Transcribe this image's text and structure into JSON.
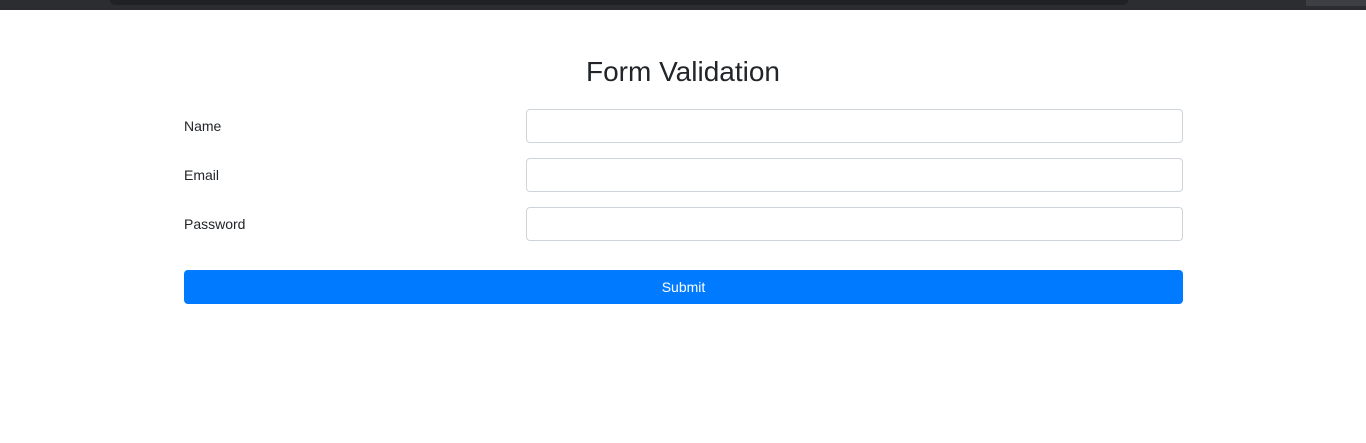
{
  "page": {
    "title": "Form Validation"
  },
  "form": {
    "fields": [
      {
        "label": "Name",
        "value": "",
        "placeholder": ""
      },
      {
        "label": "Email",
        "value": "",
        "placeholder": ""
      },
      {
        "label": "Password",
        "value": "",
        "placeholder": ""
      }
    ],
    "submit_label": "Submit"
  },
  "colors": {
    "accent": "#007bff",
    "text": "#212529",
    "input_border": "#ced4da",
    "browser_chrome": "#2b2d31"
  }
}
